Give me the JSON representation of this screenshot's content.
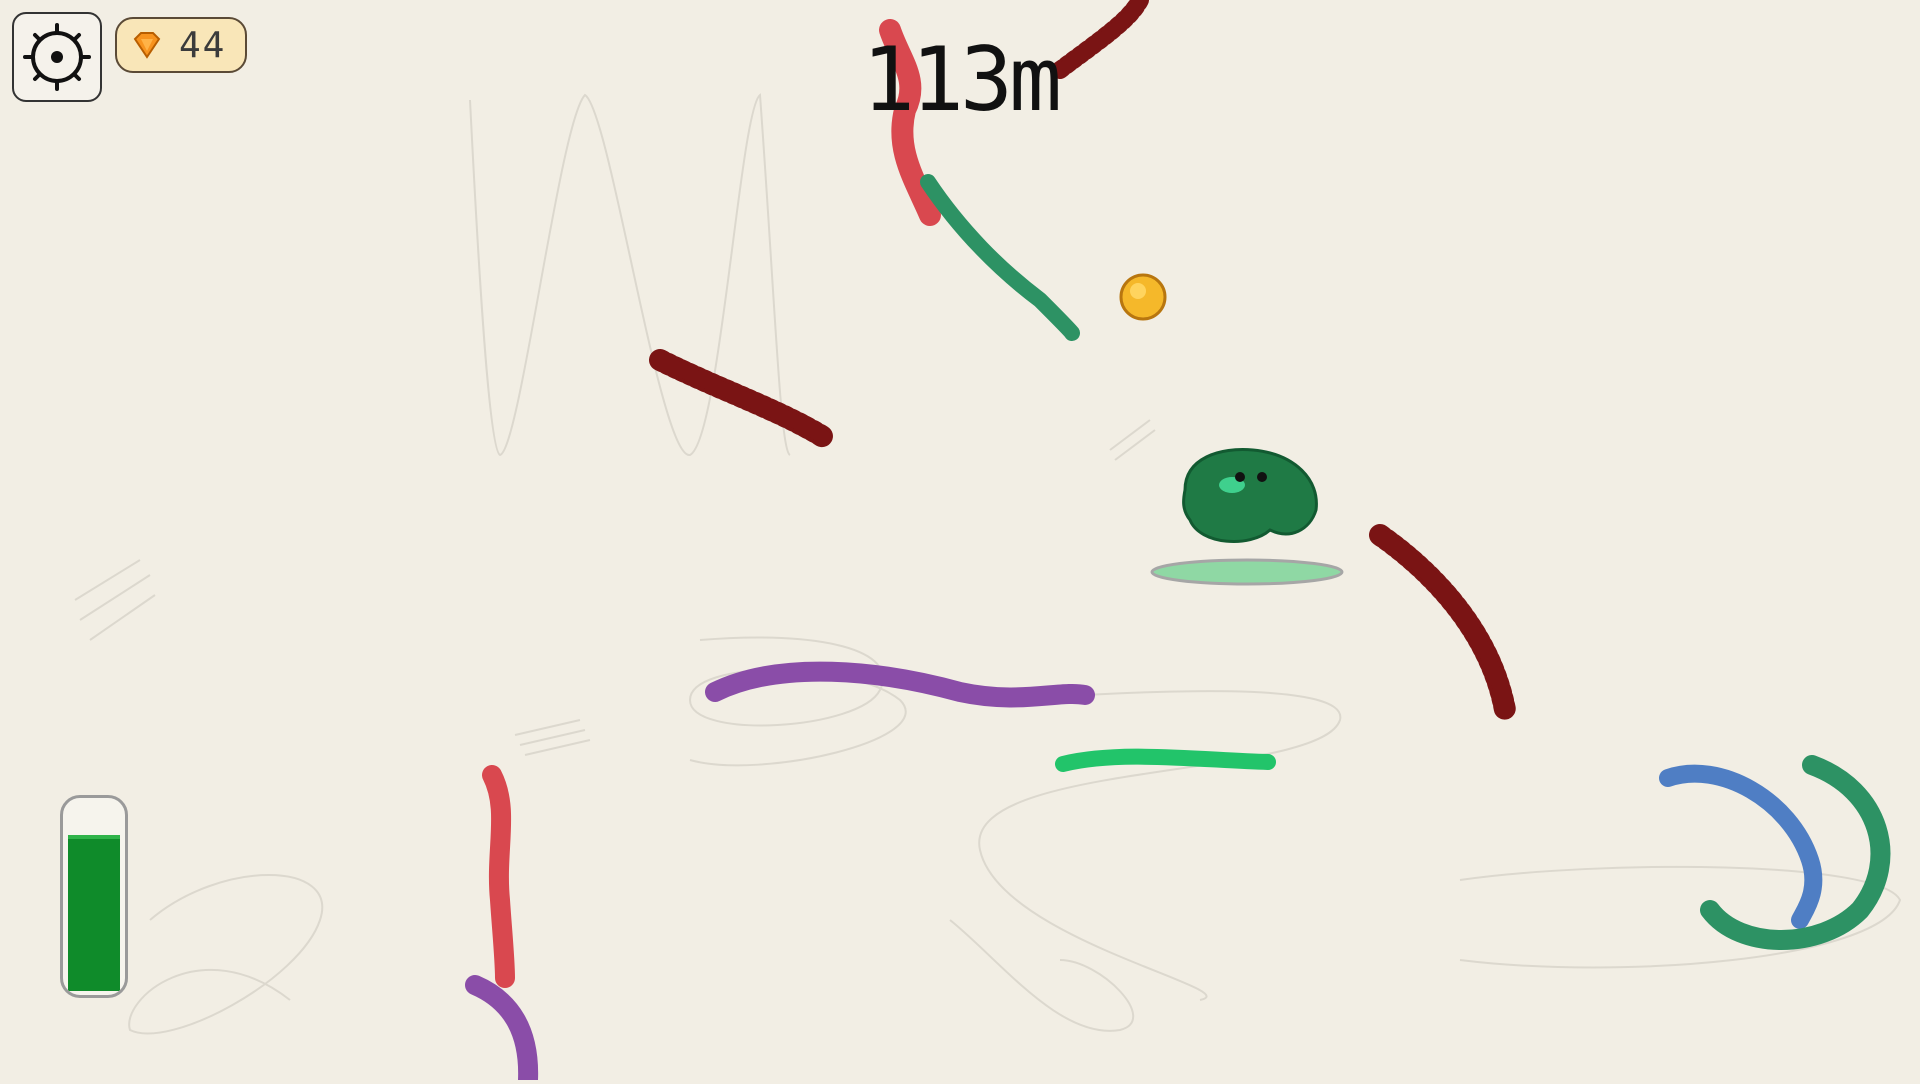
{
  "hud": {
    "settings_icon": "gear-icon",
    "gem_icon": "orange-gem-icon",
    "gem_count": "44",
    "distance": "113m",
    "ink_level": 0.86
  },
  "colors": {
    "background": "#f2eee4",
    "player": "#1f7a45",
    "spike": "#7a1414",
    "red": "#d9484f",
    "green": "#2d9264",
    "purple": "#8a4da8",
    "blue": "#4f7ec4",
    "coin": "#f5b82a",
    "ink": "#0f8b2a"
  }
}
